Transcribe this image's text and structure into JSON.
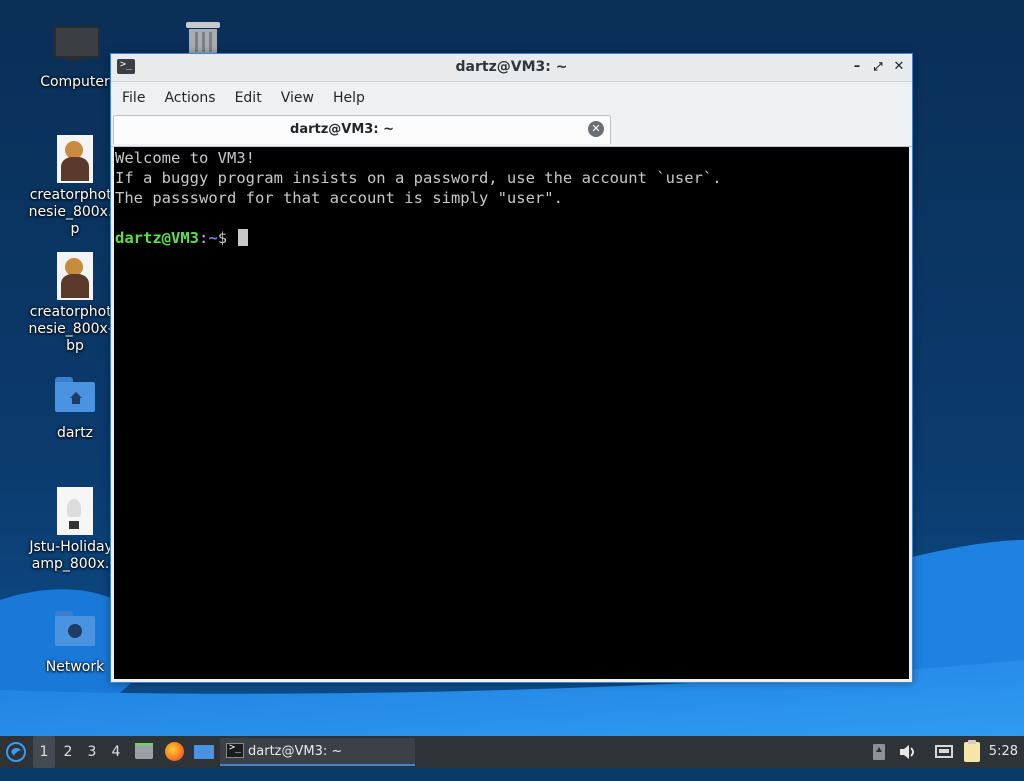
{
  "desktop": {
    "icons": [
      {
        "label": "Computer"
      },
      {
        "label": "Trash"
      },
      {
        "label": "creatorphotonesie_800x.bp"
      },
      {
        "label": "creatorphotonesie_800x-ebp"
      },
      {
        "label": "dartz"
      },
      {
        "label": "Jstu-HolidayLamp_800x.g"
      },
      {
        "label": "Network"
      }
    ]
  },
  "window": {
    "title": "dartz@VM3: ~",
    "controls": {
      "minimize": "–",
      "maximize": "⤢",
      "close": "✕"
    },
    "menu": [
      "File",
      "Actions",
      "Edit",
      "View",
      "Help"
    ],
    "tab": {
      "label": "dartz@VM3: ~",
      "close": "✕"
    },
    "terminal": {
      "lines": [
        "Welcome to VM3!",
        "If a buggy program insists on a password, use the account `user`.",
        "The passsword for that account is simply \"user\".",
        ""
      ],
      "prompt": {
        "user_host": "dartz@VM3",
        "sep": ":",
        "path": "~",
        "symbol": "$ "
      }
    }
  },
  "taskbar": {
    "workspaces": [
      "1",
      "2",
      "3",
      "4"
    ],
    "active_workspace": "1",
    "task_label": "dartz@VM3: ~",
    "clock": "5:28"
  },
  "colors": {
    "accent": "#3a84d6",
    "terminal_bg": "#000000",
    "prompt_user": "#5ee04a",
    "prompt_path": "#5f8ff0"
  }
}
